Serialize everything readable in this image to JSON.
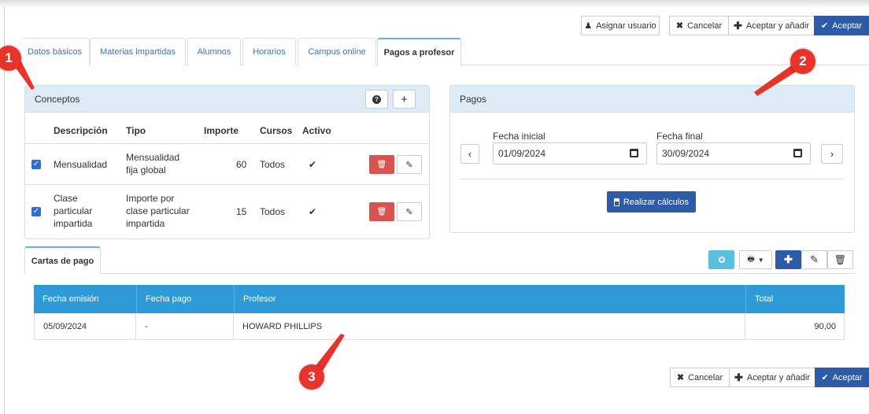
{
  "toolbar": {
    "assign_user": "Asignar usuario",
    "cancel": "Cancelar",
    "accept_add": "Aceptar y añadir",
    "accept": "Aceptar"
  },
  "tabs": [
    "Datos básicos",
    "Materias impartidas",
    "Alumnos",
    "Horarios",
    "Campus online",
    "Pagos a profesor"
  ],
  "active_tab": "Pagos a profesor",
  "conceptos": {
    "title": "Conceptos",
    "columns": [
      "Descripción",
      "Tipo",
      "Importe",
      "Cursos",
      "Activo"
    ],
    "rows": [
      {
        "checked": true,
        "descripcion": [
          "Mensualidad"
        ],
        "tipo": [
          "Mensualidad",
          "fija global"
        ],
        "importe": "60",
        "cursos": "Todos",
        "activo": "✔"
      },
      {
        "checked": true,
        "descripcion": [
          "Clase",
          "particular",
          "impartida"
        ],
        "tipo": [
          "Importe por",
          "clase particular",
          "impartida"
        ],
        "importe": "15",
        "cursos": "Todos",
        "activo": "✔"
      }
    ]
  },
  "pagos": {
    "title": "Pagos",
    "fecha_inicial_label": "Fecha inicial",
    "fecha_inicial": "01/09/2024",
    "fecha_final_label": "Fecha final",
    "fecha_final": "30/09/2024",
    "calc_button": "Realizar cálculos"
  },
  "cartas": {
    "tab": "Cartas de pago",
    "columns": [
      "Fecha emisión",
      "Fecha pago",
      "Profesor",
      "Total"
    ],
    "rows": [
      {
        "fecha_emision": "05/09/2024",
        "fecha_pago": "-",
        "profesor": "HOWARD PHILLIPS",
        "total": "90,00"
      }
    ]
  },
  "markers": [
    "1",
    "2",
    "3"
  ],
  "colors": {
    "primary": "#2d5ba7",
    "header_blue": "#2f9bd6",
    "danger": "#d9534f",
    "marker": "#e8322a",
    "panel_head": "#ddecf7"
  }
}
